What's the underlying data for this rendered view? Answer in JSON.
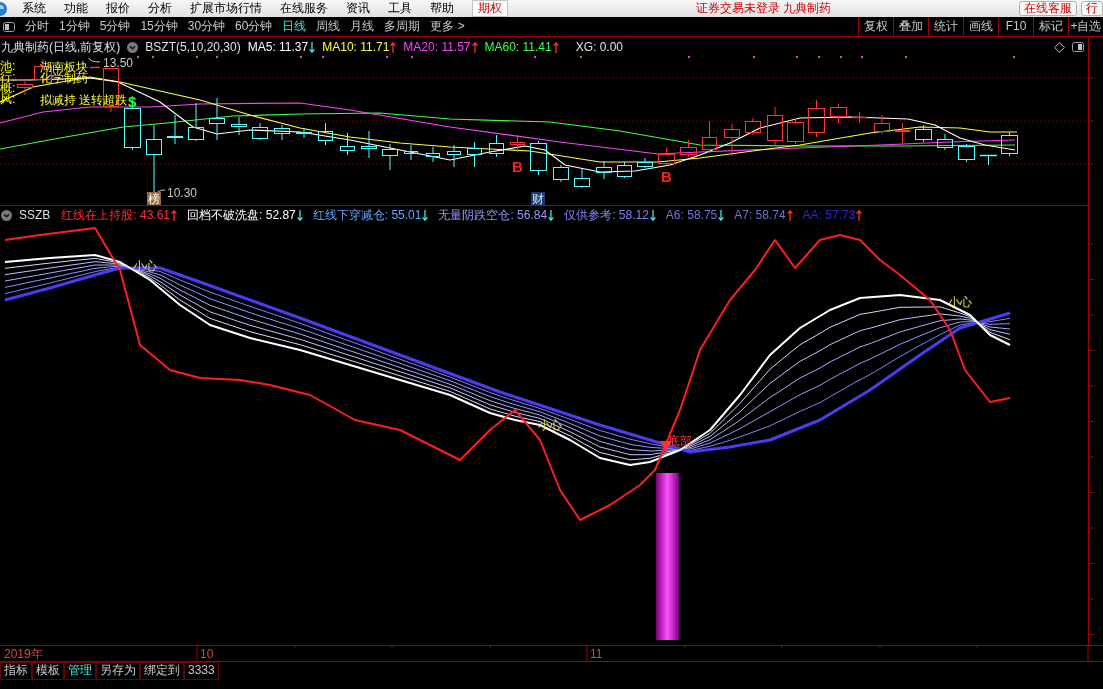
{
  "menu_bar": {
    "items": [
      "系统",
      "功能",
      "报价",
      "分析",
      "扩展市场行情",
      "在线服务",
      "资讯",
      "工具",
      "帮助"
    ],
    "option_button": "期权",
    "status_text": "证券交易未登录 九典制药",
    "buttons": [
      "在线客服",
      "行"
    ]
  },
  "period_bar": {
    "periods": [
      {
        "label": "分时",
        "selected": false
      },
      {
        "label": "1分钟",
        "selected": false
      },
      {
        "label": "5分钟",
        "selected": false
      },
      {
        "label": "15分钟",
        "selected": false
      },
      {
        "label": "30分钟",
        "selected": false
      },
      {
        "label": "60分钟",
        "selected": false
      },
      {
        "label": "日线",
        "selected": true
      },
      {
        "label": "周线",
        "selected": false
      },
      {
        "label": "月线",
        "selected": false
      },
      {
        "label": "多周期",
        "selected": false
      },
      {
        "label": "更多 >",
        "selected": false
      }
    ],
    "tools": [
      "复权",
      "叠加",
      "统计",
      "画线",
      "F10",
      "标记",
      "+自选"
    ]
  },
  "price_panel": {
    "title": "九典制药(日线,前复权)",
    "formula": "BSZT(5,10,20,30)",
    "averages": [
      {
        "text": "MA5: 11.37",
        "color": "#ffffff",
        "kind": "falling"
      },
      {
        "text": "MA10: 11.71",
        "color": "#ffff40",
        "kind": "rising"
      },
      {
        "text": "MA20: 11.57",
        "color": "#ff40ff",
        "kind": "rising"
      },
      {
        "text": "MA60: 11.41",
        "color": "#40ff40",
        "kind": "rising"
      }
    ],
    "xg": "XG: 0.00",
    "side_labels": [
      "池:",
      "行:",
      "概:",
      "风:"
    ],
    "tags": [
      "湖南板块",
      "化学制药",
      "拟减持 送转超跌"
    ],
    "high_price": "13.50",
    "low_price": "10.30",
    "events": [
      {
        "kind": "rank",
        "text": "榜"
      },
      {
        "kind": "finance",
        "text": "财"
      }
    ],
    "signals": [
      {
        "kind": "dollar",
        "text": "$"
      },
      {
        "kind": "buy",
        "text": "B"
      },
      {
        "kind": "buy",
        "text": "B"
      }
    ]
  },
  "indicator_panel": {
    "name": "SSZB",
    "readings": [
      {
        "text": "红线在上持股: 43.61",
        "color": "#ff3030",
        "kind": "rising"
      },
      {
        "text": "回档不破洗盘: 52.87",
        "color": "#ffffff",
        "kind": "falling"
      },
      {
        "text": "红线下穿减仓: 55.01",
        "color": "#60a8ff",
        "kind": "falling"
      },
      {
        "text": "无量阴跌空仓: 56.84",
        "color": "#9898ff",
        "kind": "falling"
      },
      {
        "text": "仅供参考: 58.12",
        "color": "#8080ff",
        "kind": "falling"
      },
      {
        "text": "A6: 58.75",
        "color": "#7474e0",
        "kind": "falling"
      },
      {
        "text": "A7: 58.74",
        "color": "#7070d8",
        "kind": "rising"
      },
      {
        "text": "AA: 57.73",
        "color": "#2828d8",
        "kind": "rising"
      }
    ],
    "notes": [
      "小心",
      "小心",
      "小心"
    ],
    "bottom_signal": "底部"
  },
  "time_axis": {
    "labels": [
      "2019年",
      "10",
      "11"
    ]
  },
  "bottom_tabs": [
    {
      "label": "指标",
      "selected": false
    },
    {
      "label": "模板",
      "selected": false
    },
    {
      "label": "管理",
      "selected": true
    },
    {
      "label": "另存为",
      "selected": false
    },
    {
      "label": "绑定到",
      "selected": false
    },
    {
      "label": "3333",
      "selected": false
    }
  ]
}
